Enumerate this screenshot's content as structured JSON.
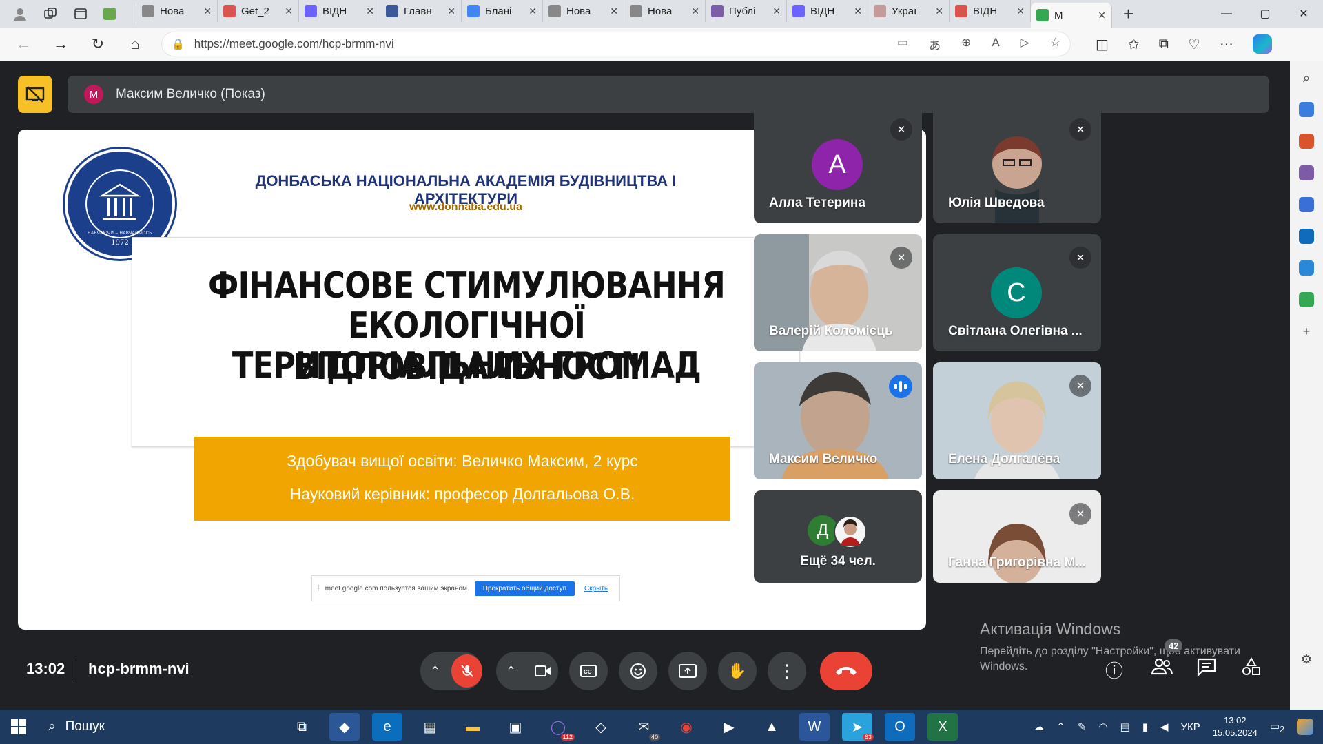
{
  "browser": {
    "tabs": [
      {
        "label": "Нова",
        "color": "#888888"
      },
      {
        "label": "Get_2",
        "color": "#d9534f"
      },
      {
        "label": "ВІДН",
        "color": "#6c63ff"
      },
      {
        "label": "Главн",
        "color": "#3b5998"
      },
      {
        "label": "Блані",
        "color": "#4285f4"
      },
      {
        "label": "Нова",
        "color": "#888888"
      },
      {
        "label": "Нова",
        "color": "#888888"
      },
      {
        "label": "Публі",
        "color": "#7b5ea7"
      },
      {
        "label": "ВІДН",
        "color": "#6c63ff"
      },
      {
        "label": "Украї",
        "color": "#c49a9a"
      },
      {
        "label": "ВІДН",
        "color": "#d9534f"
      },
      {
        "label": "М",
        "color": "#34a853"
      }
    ],
    "url": "https://meet.google.com/hcp-brmm-nvi",
    "copilot_badge": "1"
  },
  "meet": {
    "presenter_avatar": "M",
    "presenter_label": "Максим Величко (Показ)",
    "slide": {
      "academy": "ДОНБАСЬКА НАЦІОНАЛЬНА АКАДЕМІЯ БУДІВНИЦТВА І АРХІТЕКТУРИ",
      "website": "www.donnaba.edu.ua",
      "seal_motto": "НАВЧАЮЧИ – НАВЧАЄМОСЬ",
      "seal_year": "1972",
      "title_lines": [
        "ФІНАНСОВЕ СТИМУЛЮВАННЯ",
        "ЕКОЛОГІЧНОЇ ВІДПОВІДАЛЬНОСТІ",
        "ТЕРИТОРІАЛЬНИХ ГРОМАД"
      ],
      "student": "Здобувач вищої освіти: Величко Максим, 2 курс",
      "supervisor": "Науковий керівник: професор Долгальова О.В.",
      "share_notice": "meet.google.com пользуется вашим экраном.",
      "share_stop": "Прекратить общий доступ",
      "share_hide": "Скрыть"
    },
    "participants": [
      {
        "name": "Алла Тетерина",
        "initial": "А",
        "color": "#8e24aa",
        "muted": true
      },
      {
        "name": "Юлія Шведова",
        "muted": true
      },
      {
        "name": "Валерій Коломієць",
        "muted": true
      },
      {
        "name": "Світлана Олегівна ...",
        "initial": "С",
        "color": "#00897b",
        "muted": true
      },
      {
        "name": "Максим Величко",
        "speaking": true
      },
      {
        "name": "Елена Долгалёва",
        "muted": true
      },
      {
        "name": "Ещё 34 чел.",
        "initial": "Д",
        "color": "#2e7d32"
      },
      {
        "name": "Ганна Григорівна М...",
        "muted": true
      }
    ],
    "time": "13:02",
    "meeting_code": "hcp-brmm-nvi",
    "people_count": "42",
    "activation_title": "Активація Windows",
    "activation_text": "Перейдіть до розділу \"Настройки\", щоб активувати Windows."
  },
  "taskbar": {
    "search": "Пошук",
    "badges": {
      "viber": "112",
      "mail": "40",
      "telegram": "63"
    },
    "lang": "УКР",
    "time": "13:02",
    "date": "15.05.2024",
    "notif": "2"
  }
}
